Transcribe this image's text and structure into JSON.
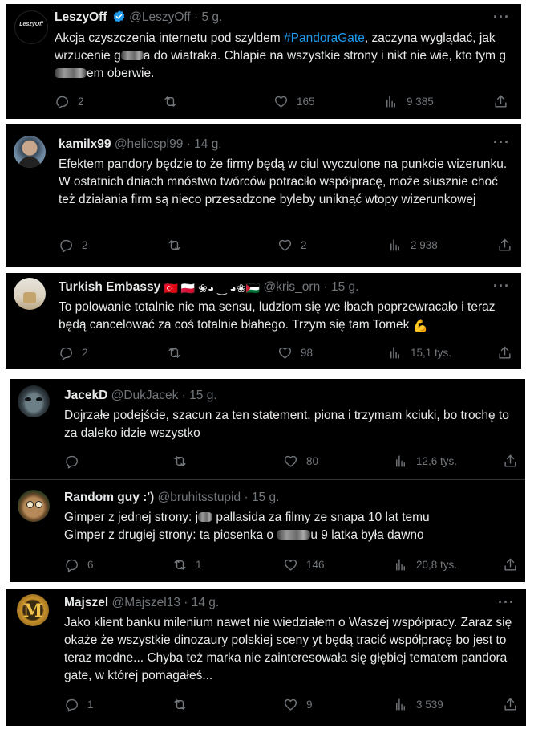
{
  "tweets": [
    {
      "name": "LeszyOff",
      "verified": true,
      "handle": "@LeszyOff",
      "time": "5 g.",
      "body_parts": [
        "Akcja czyszczenia internetu pod szyldem ",
        "#PandoraGate",
        ", zaczyna wyglądać, jak wrzucenie g",
        "a do wiatraka. Chlapie na wszystkie strony i nikt nie wie, kto tym g",
        "em oberwie."
      ],
      "replies": "2",
      "retweets": "",
      "likes": "165",
      "views": "9 385",
      "avatar_text": "LeszyOff"
    },
    {
      "name": "kamilx99",
      "handle": "@heliospl99",
      "time": "14 g.",
      "body": "Efektem pandory będzie to że firmy będą w ciul wyczulone na punkcie wizerunku. W ostatnich dniach mnóstwo twórców potraciło współpracę, może słusznie choć też działania firm są nieco przesadzone byleby uniknąć wtopy wizerunkowej",
      "replies": "2",
      "retweets": "",
      "likes": "2",
      "views": "2 938"
    },
    {
      "name": "Turkish Embassy",
      "handle": "@kris_orn",
      "time": "15 g.",
      "name_emoji": "🇹🇷 🇵🇱 ❀◕ ‿ ◕❀🇵🇸",
      "body": "To polowanie totalnie nie ma sensu, ludziom się we łbach poprzewracało i teraz będą cancelować za coś totalnie błahego. Trzym się tam Tomek",
      "body_emoji": "💪",
      "replies": "2",
      "retweets": "",
      "likes": "98",
      "views": "15,1 tys."
    },
    {
      "name": "JacekD",
      "handle": "@DukJacek",
      "time": "15 g.",
      "body": "Dojrzałe podejście, szacun za ten statement.  piona i trzymam kciuki, bo trochę to za daleko idzie wszystko",
      "replies": "",
      "retweets": "",
      "likes": "80",
      "views": "12,6 tys."
    },
    {
      "name": "Random guy :')",
      "handle": "@bruhitsstupid",
      "time": "15 g.",
      "body_parts": [
        "Gimper z jednej strony: j",
        " pallasida za filmy ze snapa 10 lat temu",
        "Gimper z drugiej strony: ta piosenka o ",
        "u 9 latka była dawno"
      ],
      "replies": "6",
      "retweets": "1",
      "likes": "146",
      "views": "20,8 tys."
    },
    {
      "name": "Majszel",
      "handle": "@Majszel13",
      "time": "14 g.",
      "body": "Jako klient banku milenium nawet nie wiedziałem o Waszej współpracy. Zaraz się okaże że wszystkie dinozaury polskiej sceny yt będą tracić współpracę bo jest to teraz modne... Chyba też marka nie zainteresowała się głębiej tematem pandora gate, w której pomagałeś...",
      "replies": "1",
      "retweets": "",
      "likes": "9",
      "views": "3 539",
      "avatar_text": "M"
    }
  ],
  "more_label": "···",
  "colors": {
    "bg": "#000000",
    "text": "#e7e9ea",
    "muted": "#71767b",
    "link": "#1d9bf0",
    "verified": "#1d9bf0"
  }
}
